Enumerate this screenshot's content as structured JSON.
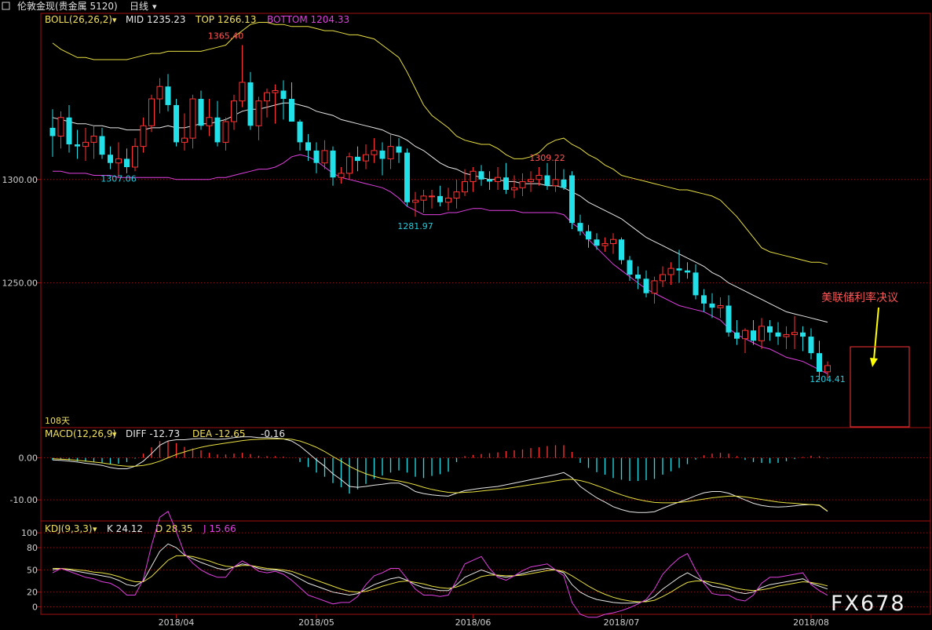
{
  "header": {
    "title": "伦敦金现(贵金属 5120)",
    "period": "日线",
    "menu_arrow": "▾"
  },
  "panels": {
    "main": {
      "indicator_label": "BOLL(26,26,2)",
      "mid": "MID 1235.23",
      "top": "TOP 1266.13",
      "bottom": "BOTTOM 1204.33",
      "ylim": [
        1180,
        1380
      ],
      "yticks": [
        {
          "v": 1300,
          "label": "1300.00"
        },
        {
          "v": 1250,
          "label": "1250.00"
        }
      ],
      "days_label": "108天",
      "annotation": "美联储利率决议",
      "value_labels": [
        {
          "text": "1365.40",
          "idx": 21,
          "price": 1368,
          "color": "#ff5555"
        },
        {
          "text": "1307.06",
          "idx": 8,
          "price": 1299,
          "color": "#22ccdd"
        },
        {
          "text": "1281.97",
          "idx": 44,
          "price": 1276,
          "color": "#22ccdd"
        },
        {
          "text": "1309.22",
          "idx": 60,
          "price": 1309,
          "color": "#ff5555"
        },
        {
          "text": "1204.41",
          "idx": 94,
          "price": 1202,
          "color": "#22ccdd"
        }
      ]
    },
    "macd": {
      "label": "MACD(12,26,9)",
      "diff": "DIFF -12.73",
      "dea": "DEA -12.65",
      "hist": "-0.16",
      "ylim": [
        -15,
        7
      ],
      "yticks": [
        {
          "v": 0,
          "label": "0.00"
        },
        {
          "v": -10,
          "label": "-10.00"
        }
      ]
    },
    "kdj": {
      "label": "KDJ(9,3,3)",
      "k": "K 24.12",
      "d": "D 28.35",
      "j": "J 15.66",
      "ylim": [
        -10,
        115
      ],
      "yticks": [
        {
          "v": 100,
          "label": "100"
        },
        {
          "v": 80,
          "label": "80"
        },
        {
          "v": 50,
          "label": "50"
        },
        {
          "v": 20,
          "label": "20"
        },
        {
          "v": 0,
          "label": "0"
        }
      ]
    }
  },
  "xaxis": {
    "labels": [
      {
        "text": "2018/04",
        "idx": 15
      },
      {
        "text": "2018/05",
        "idx": 32
      },
      {
        "text": "2018/06",
        "idx": 51
      },
      {
        "text": "2018/07",
        "idx": 69
      },
      {
        "text": "2018/08",
        "idx": 92
      }
    ]
  },
  "watermark": "FX678",
  "colors": {
    "up": "#ff3333",
    "down": "#22e0e8",
    "mid_line": "#e8e8e8",
    "top_line": "#e8e040",
    "bottom_line": "#e040e0",
    "grid": "#a01010",
    "label_yellow": "#f0e060",
    "label_magenta": "#e040e0"
  },
  "chart_data": {
    "type": "candlestick",
    "title": "伦敦金现(贵金属 5120) 日线",
    "ohlc": [
      [
        1325,
        1334,
        1311,
        1321
      ],
      [
        1321,
        1333,
        1315,
        1330
      ],
      [
        1330,
        1336,
        1313,
        1317
      ],
      [
        1317,
        1324,
        1310,
        1316
      ],
      [
        1316,
        1325,
        1309,
        1318
      ],
      [
        1318,
        1326,
        1310,
        1321
      ],
      [
        1321,
        1325,
        1310,
        1312
      ],
      [
        1312,
        1316,
        1305,
        1308
      ],
      [
        1308,
        1318,
        1301,
        1310
      ],
      [
        1310,
        1315,
        1303,
        1306
      ],
      [
        1306,
        1320,
        1304,
        1316
      ],
      [
        1316,
        1330,
        1313,
        1326
      ],
      [
        1326,
        1341,
        1323,
        1339
      ],
      [
        1339,
        1349,
        1332,
        1345
      ],
      [
        1345,
        1351,
        1333,
        1336
      ],
      [
        1336,
        1339,
        1316,
        1318
      ],
      [
        1318,
        1332,
        1314,
        1320
      ],
      [
        1320,
        1341,
        1315,
        1339
      ],
      [
        1339,
        1343,
        1324,
        1326
      ],
      [
        1326,
        1339,
        1321,
        1330
      ],
      [
        1330,
        1338,
        1316,
        1318
      ],
      [
        1318,
        1330,
        1314,
        1328
      ],
      [
        1328,
        1341,
        1324,
        1338
      ],
      [
        1338,
        1365,
        1335,
        1347
      ],
      [
        1347,
        1352,
        1324,
        1326
      ],
      [
        1326,
        1340,
        1319,
        1338
      ],
      [
        1338,
        1344,
        1330,
        1342
      ],
      [
        1342,
        1346,
        1327,
        1343
      ],
      [
        1343,
        1348,
        1329,
        1339
      ],
      [
        1339,
        1347,
        1331,
        1328
      ],
      [
        1328,
        1329,
        1314,
        1318
      ],
      [
        1318,
        1322,
        1309,
        1314
      ],
      [
        1314,
        1318,
        1303,
        1308
      ],
      [
        1308,
        1319,
        1305,
        1314
      ],
      [
        1314,
        1316,
        1297,
        1301
      ],
      [
        1301,
        1306,
        1298,
        1303
      ],
      [
        1303,
        1313,
        1300,
        1311
      ],
      [
        1311,
        1316,
        1304,
        1309
      ],
      [
        1309,
        1317,
        1305,
        1312
      ],
      [
        1312,
        1320,
        1308,
        1314
      ],
      [
        1314,
        1318,
        1302,
        1310
      ],
      [
        1310,
        1322,
        1305,
        1316
      ],
      [
        1316,
        1320,
        1308,
        1313
      ],
      [
        1313,
        1315,
        1287,
        1289
      ],
      [
        1289,
        1294,
        1282,
        1290
      ],
      [
        1290,
        1295,
        1284,
        1292
      ],
      [
        1292,
        1295,
        1286,
        1292
      ],
      [
        1292,
        1297,
        1287,
        1289
      ],
      [
        1289,
        1296,
        1285,
        1291
      ],
      [
        1291,
        1300,
        1286,
        1294
      ],
      [
        1294,
        1305,
        1292,
        1299
      ],
      [
        1299,
        1306,
        1294,
        1304
      ],
      [
        1304,
        1307,
        1297,
        1300
      ],
      [
        1300,
        1304,
        1295,
        1299
      ],
      [
        1299,
        1306,
        1295,
        1301
      ],
      [
        1301,
        1308,
        1293,
        1295
      ],
      [
        1295,
        1302,
        1291,
        1296
      ],
      [
        1296,
        1303,
        1292,
        1299
      ],
      [
        1299,
        1304,
        1294,
        1300
      ],
      [
        1300,
        1306,
        1297,
        1302
      ],
      [
        1302,
        1308,
        1295,
        1297
      ],
      [
        1297,
        1309,
        1294,
        1300
      ],
      [
        1300,
        1305,
        1295,
        1296
      ],
      [
        1302,
        1304,
        1276,
        1279
      ],
      [
        1279,
        1283,
        1273,
        1275
      ],
      [
        1275,
        1278,
        1267,
        1271
      ],
      [
        1271,
        1274,
        1266,
        1268
      ],
      [
        1268,
        1272,
        1265,
        1269
      ],
      [
        1269,
        1274,
        1264,
        1271
      ],
      [
        1271,
        1272,
        1259,
        1261
      ],
      [
        1261,
        1263,
        1251,
        1254
      ],
      [
        1254,
        1258,
        1247,
        1252
      ],
      [
        1252,
        1256,
        1243,
        1245
      ],
      [
        1245,
        1253,
        1240,
        1251
      ],
      [
        1251,
        1258,
        1248,
        1254
      ],
      [
        1254,
        1260,
        1249,
        1257
      ],
      [
        1257,
        1266,
        1250,
        1256
      ],
      [
        1256,
        1260,
        1252,
        1255
      ],
      [
        1255,
        1259,
        1242,
        1244
      ],
      [
        1244,
        1247,
        1236,
        1240
      ],
      [
        1240,
        1245,
        1233,
        1238
      ],
      [
        1238,
        1243,
        1233,
        1239
      ],
      [
        1239,
        1244,
        1224,
        1226
      ],
      [
        1226,
        1232,
        1220,
        1223
      ],
      [
        1223,
        1228,
        1216,
        1227
      ],
      [
        1227,
        1232,
        1220,
        1222
      ],
      [
        1222,
        1233,
        1218,
        1229
      ],
      [
        1229,
        1232,
        1222,
        1226
      ],
      [
        1226,
        1231,
        1220,
        1224
      ],
      [
        1224,
        1229,
        1218,
        1225
      ],
      [
        1225,
        1234,
        1218,
        1226
      ],
      [
        1226,
        1229,
        1217,
        1224
      ],
      [
        1224,
        1228,
        1213,
        1216
      ],
      [
        1216,
        1222,
        1203,
        1207
      ],
      [
        1207,
        1212,
        1204,
        1210
      ]
    ],
    "boll_mid": [
      1330,
      1329,
      1328,
      1327,
      1327,
      1326,
      1326,
      1325,
      1325,
      1324,
      1324,
      1324,
      1325,
      1325,
      1326,
      1325,
      1325,
      1326,
      1327,
      1327,
      1328,
      1329,
      1331,
      1333,
      1334,
      1334,
      1335,
      1336,
      1337,
      1337,
      1336,
      1335,
      1333,
      1332,
      1331,
      1329,
      1328,
      1327,
      1326,
      1325,
      1324,
      1322,
      1321,
      1319,
      1316,
      1314,
      1311,
      1308,
      1306,
      1305,
      1303,
      1302,
      1301,
      1300,
      1300,
      1299,
      1299,
      1298,
      1298,
      1298,
      1297,
      1297,
      1296,
      1294,
      1292,
      1289,
      1287,
      1285,
      1283,
      1281,
      1278,
      1275,
      1272,
      1270,
      1268,
      1266,
      1264,
      1262,
      1260,
      1258,
      1255,
      1253,
      1250,
      1248,
      1246,
      1244,
      1242,
      1240,
      1238,
      1236,
      1235,
      1234,
      1233,
      1232,
      1231
    ],
    "boll_top": [
      1366,
      1363,
      1361,
      1359,
      1359,
      1358,
      1358,
      1358,
      1358,
      1358,
      1359,
      1360,
      1361,
      1361,
      1362,
      1362,
      1362,
      1362,
      1362,
      1363,
      1364,
      1365,
      1369,
      1372,
      1375,
      1376,
      1376,
      1375,
      1375,
      1374,
      1374,
      1374,
      1373,
      1372,
      1372,
      1371,
      1370,
      1370,
      1369,
      1368,
      1365,
      1362,
      1359,
      1352,
      1344,
      1336,
      1331,
      1328,
      1325,
      1321,
      1319,
      1318,
      1317,
      1317,
      1315,
      1312,
      1310,
      1310,
      1311,
      1313,
      1317,
      1319,
      1320,
      1317,
      1315,
      1312,
      1310,
      1307,
      1305,
      1302,
      1301,
      1300,
      1299,
      1298,
      1297,
      1296,
      1295,
      1295,
      1294,
      1293,
      1292,
      1290,
      1286,
      1282,
      1277,
      1272,
      1267,
      1265,
      1264,
      1263,
      1262,
      1261,
      1260,
      1260,
      1259
    ],
    "boll_bottom": [
      1304,
      1304,
      1303,
      1303,
      1303,
      1302,
      1302,
      1302,
      1301,
      1301,
      1301,
      1301,
      1301,
      1301,
      1301,
      1300,
      1300,
      1300,
      1300,
      1300,
      1301,
      1301,
      1302,
      1303,
      1304,
      1305,
      1305,
      1306,
      1308,
      1311,
      1312,
      1311,
      1309,
      1306,
      1303,
      1301,
      1300,
      1299,
      1298,
      1297,
      1296,
      1294,
      1291,
      1287,
      1285,
      1283,
      1283,
      1283,
      1284,
      1284,
      1285,
      1286,
      1286,
      1285,
      1285,
      1285,
      1285,
      1284,
      1284,
      1284,
      1284,
      1284,
      1283,
      1279,
      1276,
      1271,
      1267,
      1263,
      1259,
      1256,
      1253,
      1250,
      1247,
      1245,
      1243,
      1241,
      1239,
      1238,
      1237,
      1236,
      1234,
      1232,
      1228,
      1225,
      1223,
      1221,
      1219,
      1218,
      1216,
      1214,
      1213,
      1212,
      1210,
      1208,
      1206
    ],
    "macd_hist": [
      -0.5,
      -0.4,
      -0.6,
      -0.8,
      -0.9,
      -1.0,
      -1.2,
      -1.5,
      -1.4,
      -1.0,
      -0.2,
      1.0,
      2.5,
      4.0,
      4.0,
      3.5,
      2.6,
      2.2,
      1.8,
      1.2,
      0.8,
      0.8,
      1.0,
      1.2,
      0.9,
      0.5,
      0.4,
      0.4,
      0.3,
      0.0,
      -1.0,
      -2.2,
      -3.5,
      -4.5,
      -6.0,
      -7.0,
      -8.5,
      -7.5,
      -6.2,
      -5.0,
      -4.2,
      -3.5,
      -3.0,
      -3.5,
      -4.5,
      -4.8,
      -4.3,
      -3.9,
      -3.3,
      -1.0,
      0.4,
      0.7,
      0.9,
      1.1,
      1.3,
      1.6,
      1.8,
      2.0,
      2.3,
      2.5,
      2.8,
      3.0,
      3.0,
      1.4,
      -1.2,
      -2.4,
      -3.4,
      -4.0,
      -4.8,
      -5.2,
      -5.5,
      -5.5,
      -5.3,
      -5.0,
      -4.0,
      -3.2,
      -2.4,
      -1.5,
      -0.4,
      0.6,
      1.0,
      1.2,
      1.0,
      0.4,
      -0.5,
      -1.0,
      -1.2,
      -1.3,
      -1.2,
      -0.8,
      -0.3,
      0.2,
      0.5,
      0.4,
      -0.16
    ],
    "macd_diff": [
      -0.5,
      -0.6,
      -0.8,
      -1.0,
      -1.3,
      -1.5,
      -1.8,
      -2.3,
      -2.6,
      -2.6,
      -2.0,
      -0.8,
      1.0,
      3.0,
      4.0,
      4.3,
      4.3,
      4.5,
      4.6,
      4.5,
      4.4,
      4.5,
      4.8,
      5.0,
      5.0,
      4.8,
      4.8,
      4.7,
      4.5,
      4.0,
      2.8,
      1.2,
      -0.5,
      -2.0,
      -3.8,
      -5.2,
      -6.8,
      -7.0,
      -6.8,
      -6.5,
      -6.3,
      -6.0,
      -6.0,
      -6.8,
      -8.0,
      -8.5,
      -8.8,
      -9.0,
      -9.1,
      -8.4,
      -7.8,
      -7.5,
      -7.2,
      -7.0,
      -6.8,
      -6.4,
      -6.0,
      -5.6,
      -5.2,
      -4.8,
      -4.4,
      -4.0,
      -3.5,
      -4.7,
      -6.8,
      -8.2,
      -9.5,
      -10.5,
      -11.6,
      -12.3,
      -12.8,
      -13.0,
      -13.0,
      -12.8,
      -12.0,
      -11.2,
      -10.5,
      -9.8,
      -9.0,
      -8.3,
      -8.0,
      -8.0,
      -8.4,
      -9.2,
      -10.0,
      -10.8,
      -11.3,
      -11.6,
      -11.7,
      -11.6,
      -11.4,
      -11.2,
      -11.1,
      -11.3,
      -12.73
    ],
    "macd_dea": [
      -0.2,
      -0.3,
      -0.4,
      -0.6,
      -0.8,
      -1.0,
      -1.2,
      -1.5,
      -1.8,
      -2.0,
      -2.0,
      -1.8,
      -1.4,
      -0.8,
      0.0,
      0.8,
      1.4,
      2.0,
      2.5,
      2.9,
      3.2,
      3.5,
      3.8,
      4.1,
      4.3,
      4.4,
      4.5,
      4.5,
      4.5,
      4.4,
      4.0,
      3.3,
      2.5,
      1.5,
      0.3,
      -0.8,
      -2.0,
      -3.0,
      -3.8,
      -4.4,
      -4.9,
      -5.2,
      -5.5,
      -5.9,
      -6.4,
      -7.0,
      -7.5,
      -7.9,
      -8.2,
      -8.3,
      -8.2,
      -8.1,
      -7.9,
      -7.7,
      -7.5,
      -7.3,
      -7.0,
      -6.7,
      -6.4,
      -6.1,
      -5.8,
      -5.5,
      -5.2,
      -5.1,
      -5.4,
      -5.9,
      -6.6,
      -7.3,
      -8.1,
      -8.8,
      -9.4,
      -9.9,
      -10.3,
      -10.6,
      -10.7,
      -10.7,
      -10.6,
      -10.4,
      -10.1,
      -9.8,
      -9.5,
      -9.3,
      -9.1,
      -9.1,
      -9.3,
      -9.6,
      -9.9,
      -10.2,
      -10.5,
      -10.7,
      -10.8,
      -11.0,
      -11.1,
      -11.2,
      -12.65
    ],
    "kdj_k": [
      50,
      52,
      50,
      48,
      46,
      44,
      42,
      40,
      36,
      30,
      28,
      35,
      55,
      75,
      85,
      80,
      70,
      65,
      60,
      56,
      52,
      50,
      54,
      58,
      56,
      52,
      50,
      50,
      48,
      44,
      38,
      32,
      28,
      24,
      20,
      18,
      16,
      18,
      24,
      30,
      34,
      38,
      40,
      36,
      30,
      26,
      24,
      22,
      22,
      30,
      40,
      45,
      50,
      46,
      42,
      40,
      42,
      45,
      48,
      50,
      52,
      50,
      46,
      30,
      20,
      14,
      10,
      8,
      6,
      5,
      5,
      6,
      8,
      14,
      24,
      32,
      40,
      46,
      40,
      34,
      28,
      26,
      24,
      20,
      18,
      20,
      26,
      30,
      32,
      34,
      36,
      38,
      32,
      28,
      24.12
    ],
    "kdj_d": [
      52,
      52,
      51,
      50,
      49,
      47,
      46,
      44,
      41,
      37,
      34,
      34,
      41,
      52,
      63,
      69,
      69,
      68,
      65,
      62,
      58,
      55,
      54,
      56,
      56,
      54,
      52,
      51,
      50,
      48,
      44,
      40,
      36,
      32,
      28,
      24,
      21,
      20,
      21,
      24,
      28,
      31,
      34,
      35,
      33,
      31,
      28,
      26,
      25,
      27,
      31,
      36,
      41,
      43,
      43,
      42,
      42,
      43,
      45,
      47,
      49,
      50,
      48,
      42,
      35,
      28,
      22,
      17,
      13,
      10,
      8,
      7,
      7,
      9,
      14,
      20,
      27,
      33,
      35,
      35,
      33,
      31,
      28,
      25,
      23,
      22,
      23,
      25,
      28,
      30,
      32,
      34,
      33,
      31,
      28.35
    ],
    "kdj_j": [
      46,
      52,
      48,
      44,
      40,
      38,
      34,
      32,
      26,
      16,
      16,
      37,
      83,
      121,
      129,
      102,
      72,
      59,
      50,
      44,
      40,
      40,
      54,
      62,
      56,
      48,
      46,
      48,
      44,
      36,
      26,
      16,
      12,
      8,
      4,
      6,
      6,
      14,
      30,
      42,
      46,
      52,
      52,
      38,
      24,
      16,
      16,
      14,
      16,
      36,
      58,
      63,
      68,
      52,
      40,
      36,
      42,
      49,
      54,
      56,
      58,
      50,
      42,
      6,
      -10,
      -14,
      -14,
      -10,
      -8,
      -5,
      -1,
      4,
      10,
      24,
      44,
      56,
      66,
      72,
      50,
      32,
      18,
      16,
      16,
      10,
      8,
      16,
      32,
      40,
      40,
      42,
      44,
      46,
      30,
      22,
      15.66
    ]
  }
}
